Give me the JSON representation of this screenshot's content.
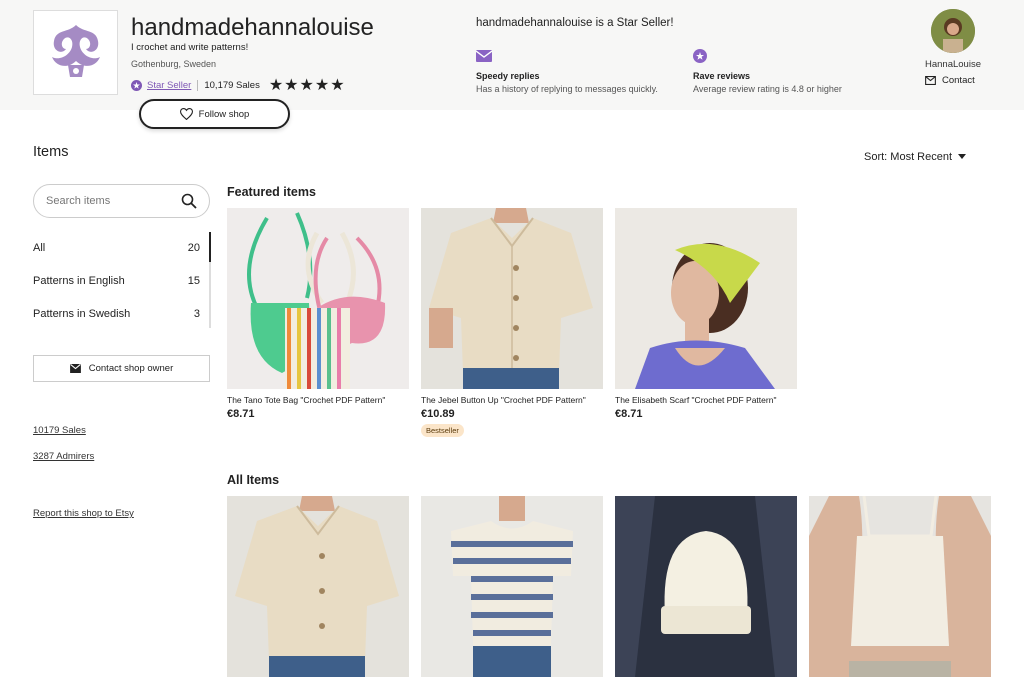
{
  "header": {
    "shop_name": "handmadehannalouise",
    "tagline": "I crochet and write patterns!",
    "location": "Gothenburg, Sweden",
    "star_seller_label": "Star Seller",
    "sales": "10,179 Sales",
    "rating_stars": "★★★★★",
    "follow_label": "Follow shop",
    "star_seller_statement": "handmadehannalouise is a Star Seller!",
    "features": [
      {
        "title": "Speedy replies",
        "desc": "Has a history of replying to messages quickly."
      },
      {
        "title": "Rave reviews",
        "desc": "Average review rating is 4.8 or higher"
      }
    ],
    "owner_name": "HannaLouise",
    "contact_label": "Contact",
    "accent": "#7f58b5"
  },
  "sidebar": {
    "heading": "Items",
    "search_placeholder": "Search items",
    "categories": [
      {
        "label": "All",
        "count": "20"
      },
      {
        "label": "Patterns in English",
        "count": "15"
      },
      {
        "label": "Patterns in Swedish",
        "count": "3"
      }
    ],
    "contact_owner": "Contact shop owner",
    "sales_link": "10179 Sales",
    "admirers_link": "3287 Admirers",
    "report_link": "Report this shop to Etsy"
  },
  "main": {
    "sort_label": "Sort: Most Recent",
    "featured_heading": "Featured items",
    "featured": [
      {
        "title": "The Tano Tote Bag \"Crochet PDF Pattern\"",
        "price": "€8.71",
        "badge": ""
      },
      {
        "title": "The Jebel Button Up \"Crochet PDF Pattern\"",
        "price": "€10.89",
        "badge": "Bestseller"
      },
      {
        "title": "The Elisabeth Scarf \"Crochet PDF Pattern\"",
        "price": "€8.71",
        "badge": ""
      }
    ],
    "all_heading": "All Items"
  }
}
